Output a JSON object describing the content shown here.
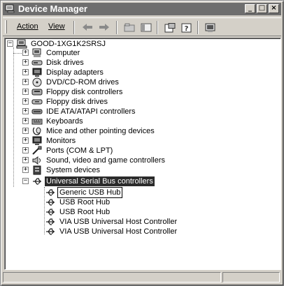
{
  "window": {
    "title": "Device Manager",
    "buttons": {
      "minimize": "_",
      "maximize": "□",
      "close": "×"
    }
  },
  "toolbar": {
    "menu_action": "Action",
    "menu_view": "View",
    "back_icon": "back-arrow-icon",
    "forward_icon": "forward-arrow-icon"
  },
  "tree": {
    "root": "GOOD-1XG1K2SRSJ",
    "categories": [
      {
        "label": "Computer",
        "icon": "computer-icon"
      },
      {
        "label": "Disk drives",
        "icon": "disk-drive-icon"
      },
      {
        "label": "Display adapters",
        "icon": "monitor-icon"
      },
      {
        "label": "DVD/CD-ROM drives",
        "icon": "cdrom-icon"
      },
      {
        "label": "Floppy disk controllers",
        "icon": "floppy-controller-icon"
      },
      {
        "label": "Floppy disk drives",
        "icon": "floppy-drive-icon"
      },
      {
        "label": "IDE ATA/ATAPI controllers",
        "icon": "ide-controller-icon"
      },
      {
        "label": "Keyboards",
        "icon": "keyboard-icon"
      },
      {
        "label": "Mice and other pointing devices",
        "icon": "mouse-icon"
      },
      {
        "label": "Monitors",
        "icon": "monitor-icon"
      },
      {
        "label": "Ports (COM & LPT)",
        "icon": "port-icon"
      },
      {
        "label": "Sound, video and game controllers",
        "icon": "sound-icon"
      },
      {
        "label": "System devices",
        "icon": "system-devices-icon"
      },
      {
        "label": "Universal Serial Bus controllers",
        "icon": "usb-icon"
      }
    ],
    "usb_children": [
      "Generic USB Hub",
      "USB Root Hub",
      "USB Root Hub",
      "VIA USB Universal Host Controller",
      "VIA USB Universal Host Controller"
    ],
    "expander_collapsed": "+",
    "expander_expanded": "−"
  }
}
